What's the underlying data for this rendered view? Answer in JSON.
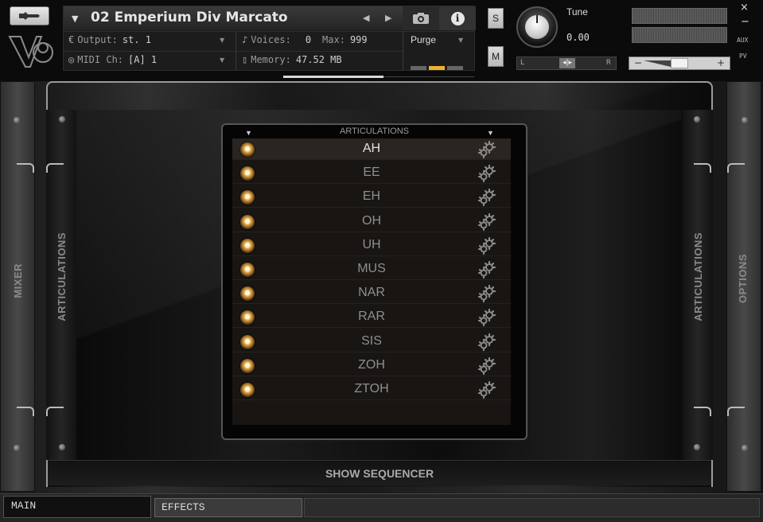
{
  "header": {
    "instrument_title": "02 Emperium Div Marcato",
    "output_label": "Output:",
    "output_value": "st. 1",
    "voices_label": "Voices:",
    "voices_value": "0",
    "max_label": "Max:",
    "max_value": "999",
    "purge_label": "Purge",
    "midi_label": "MIDI Ch:",
    "midi_value": "[A] 1",
    "memory_label": "Memory:",
    "memory_value": "47.52 MB",
    "solo_label": "S",
    "mute_label": "M",
    "tune_label": "Tune",
    "tune_value": "0.00",
    "pan_left": "L",
    "pan_right": "R",
    "aux_label": "AUX",
    "pv_label": "PV",
    "close_glyph": "×",
    "minimize_glyph": "−"
  },
  "sidebars": {
    "left_outer": "MIXER",
    "left_inner": "ARTICULATIONS",
    "right_inner": "ARTICULATIONS",
    "right_outer": "OPTIONS"
  },
  "articulations": {
    "header": "ARTICULATIONS",
    "selected_index": 0,
    "items": [
      "AH",
      "EE",
      "EH",
      "OH",
      "UH",
      "MUS",
      "NAR",
      "RAR",
      "SIS",
      "ZOH",
      "ZTOH"
    ]
  },
  "footer": {
    "show_sequencer": "SHOW SEQUENCER"
  },
  "tabs": {
    "main": "MAIN",
    "effects": "EFFECTS"
  },
  "colors": {
    "led_glow": "#e7b55a",
    "purge_on": "#f0b030",
    "selected_text": "#e2e2e2",
    "unselected_text": "#8f8f8f"
  }
}
